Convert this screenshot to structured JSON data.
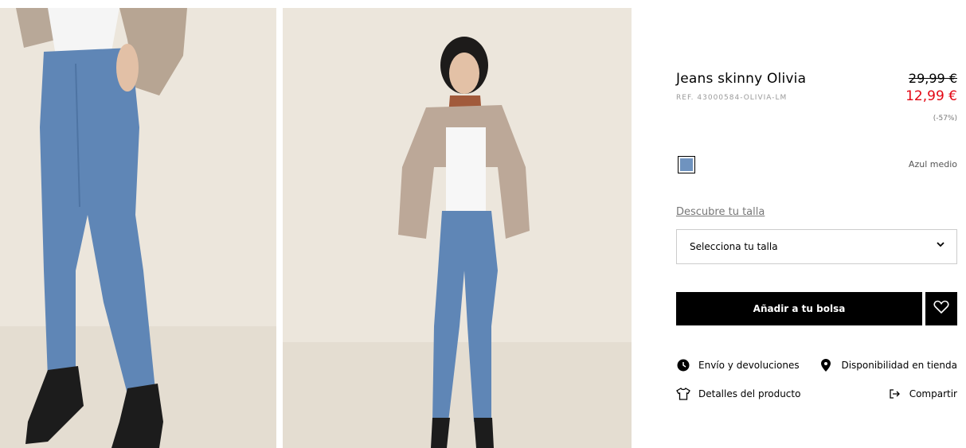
{
  "product": {
    "title": "Jeans skinny Olivia",
    "ref": "REF. 43000584-OLIVIA-LM",
    "old_price": "29,99 €",
    "new_price": "12,99 €",
    "discount": "(-57%)",
    "color_name": "Azul medio",
    "swatch_color": "#6f93bf",
    "price_color": "#e30613"
  },
  "size": {
    "guide_link": "Descubre tu talla",
    "select_label": "Selecciona tu talla"
  },
  "actions": {
    "add_to_bag": "Añadir a tu bolsa",
    "shipping": "Envío y devoluciones",
    "store": "Disponibilidad en tienda",
    "details": "Detalles del producto",
    "share": "Compartir"
  },
  "icons": [
    "chevron-down-icon",
    "heart-icon",
    "clock-icon",
    "location-pin-icon",
    "tshirt-icon",
    "share-icon"
  ]
}
